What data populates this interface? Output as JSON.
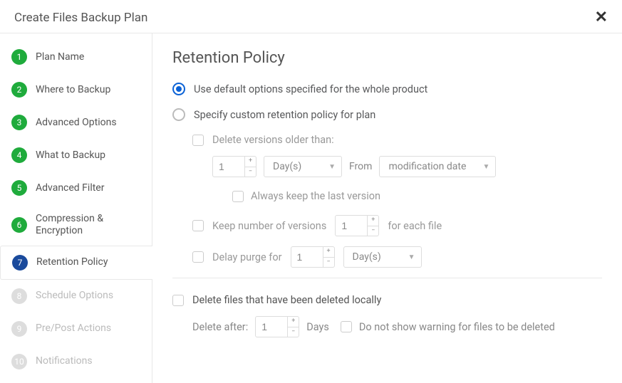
{
  "dialog": {
    "title": "Create Files Backup Plan"
  },
  "steps": [
    {
      "num": "1",
      "label": "Plan Name",
      "state": "done"
    },
    {
      "num": "2",
      "label": "Where to Backup",
      "state": "done"
    },
    {
      "num": "3",
      "label": "Advanced Options",
      "state": "done"
    },
    {
      "num": "4",
      "label": "What to Backup",
      "state": "done"
    },
    {
      "num": "5",
      "label": "Advanced Filter",
      "state": "done"
    },
    {
      "num": "6",
      "label": "Compression & Encryption",
      "state": "done"
    },
    {
      "num": "7",
      "label": "Retention Policy",
      "state": "current"
    },
    {
      "num": "8",
      "label": "Schedule Options",
      "state": "pending"
    },
    {
      "num": "9",
      "label": "Pre/Post Actions",
      "state": "pending"
    },
    {
      "num": "10",
      "label": "Notifications",
      "state": "pending"
    }
  ],
  "page": {
    "title": "Retention Policy",
    "option_default": "Use default options specified for the whole product",
    "option_custom": "Specify custom retention policy for plan",
    "delete_older_label": "Delete versions older than:",
    "delete_older_value": "1",
    "delete_older_unit": "Day(s)",
    "from_label": "From",
    "from_value": "modification date",
    "always_keep_label": "Always keep the last version",
    "keep_versions_label": "Keep number of versions",
    "keep_versions_value": "1",
    "keep_versions_suffix": "for each file",
    "delay_purge_label": "Delay purge for",
    "delay_purge_value": "1",
    "delay_purge_unit": "Day(s)",
    "delete_local_label": "Delete files that have been deleted locally",
    "delete_after_label": "Delete after:",
    "delete_after_value": "1",
    "delete_after_unit": "Days",
    "no_warning_label": "Do not show warning for files to be deleted"
  }
}
